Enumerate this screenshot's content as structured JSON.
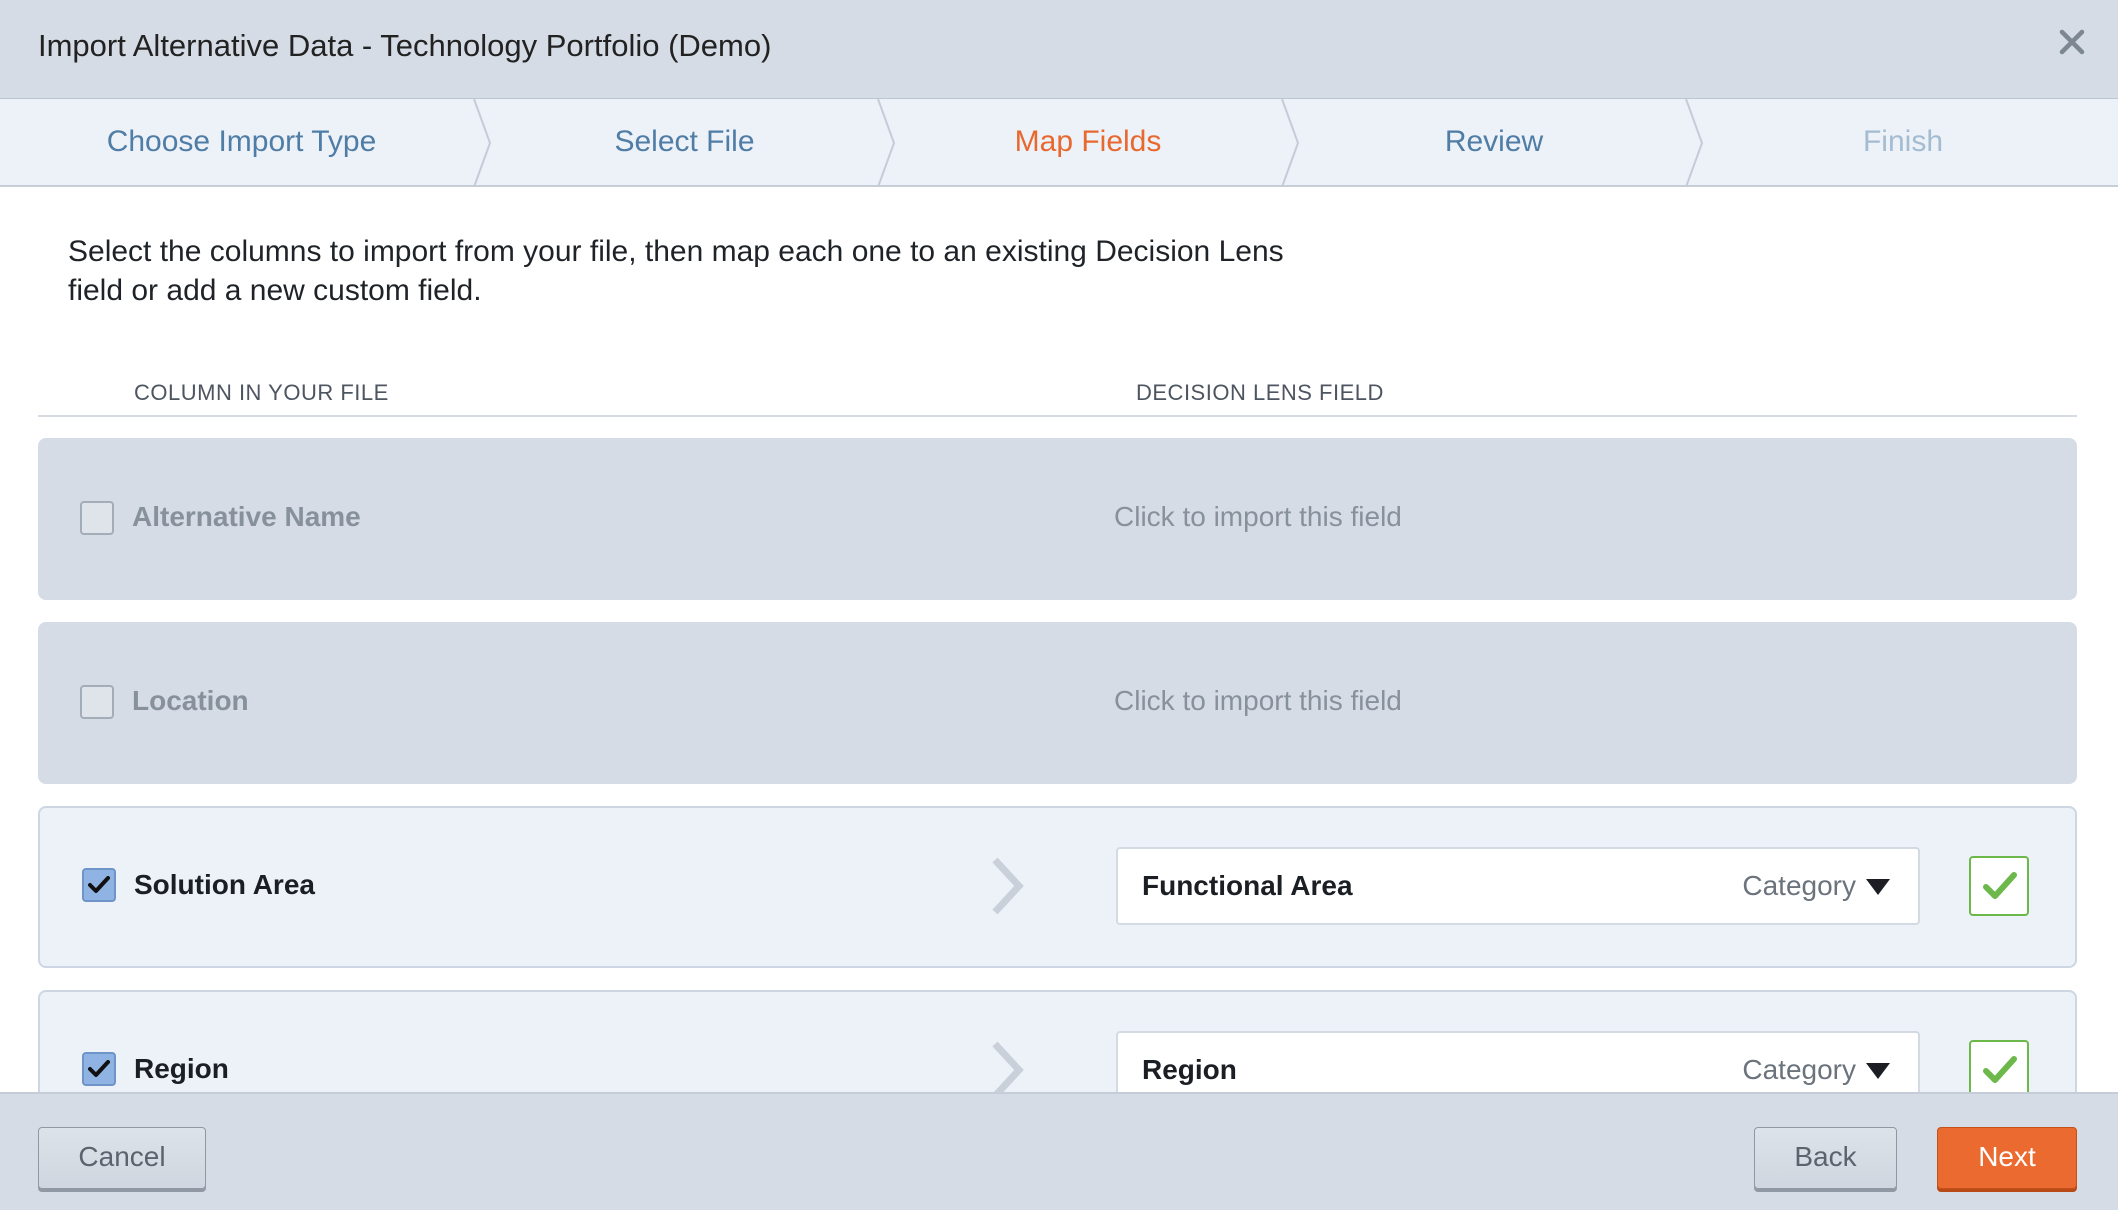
{
  "dialog": {
    "title": "Import Alternative Data - Technology Portfolio (Demo)"
  },
  "steps": [
    {
      "label": "Choose Import Type",
      "state": "done"
    },
    {
      "label": "Select File",
      "state": "done"
    },
    {
      "label": "Map Fields",
      "state": "active"
    },
    {
      "label": "Review",
      "state": "done"
    },
    {
      "label": "Finish",
      "state": "disabled"
    }
  ],
  "intro": {
    "line1": "Select the columns to import from your file, then map each one to an existing Decision Lens",
    "line2": "field or add a new custom field."
  },
  "columns": {
    "file_header": "COLUMN IN YOUR FILE",
    "lens_header": "DECISION LENS FIELD"
  },
  "rows": [
    {
      "name": "Alternative Name",
      "checked": false,
      "placeholder": "Click to import this field"
    },
    {
      "name": "Location",
      "checked": false,
      "placeholder": "Click to import this field"
    },
    {
      "name": "Solution Area",
      "checked": true,
      "mapped_field": "Functional Area",
      "field_type": "Category"
    },
    {
      "name": "Region",
      "checked": true,
      "mapped_field": "Region",
      "field_type": "Category"
    }
  ],
  "footer": {
    "cancel_label": "Cancel",
    "back_label": "Back",
    "next_label": "Next"
  },
  "icons": {
    "close": "close-icon",
    "checkbox": "checkmark-icon",
    "map_arrow": "chevron-right-icon",
    "dropdown": "caret-down-icon",
    "confirm": "confirm-check-icon"
  },
  "colors": {
    "accent": "#ea6a2f",
    "active_step": "#e8692f",
    "done_step": "#4f7da6",
    "disabled_step": "#a4bcd1",
    "confirm_green": "#6cb84a"
  }
}
